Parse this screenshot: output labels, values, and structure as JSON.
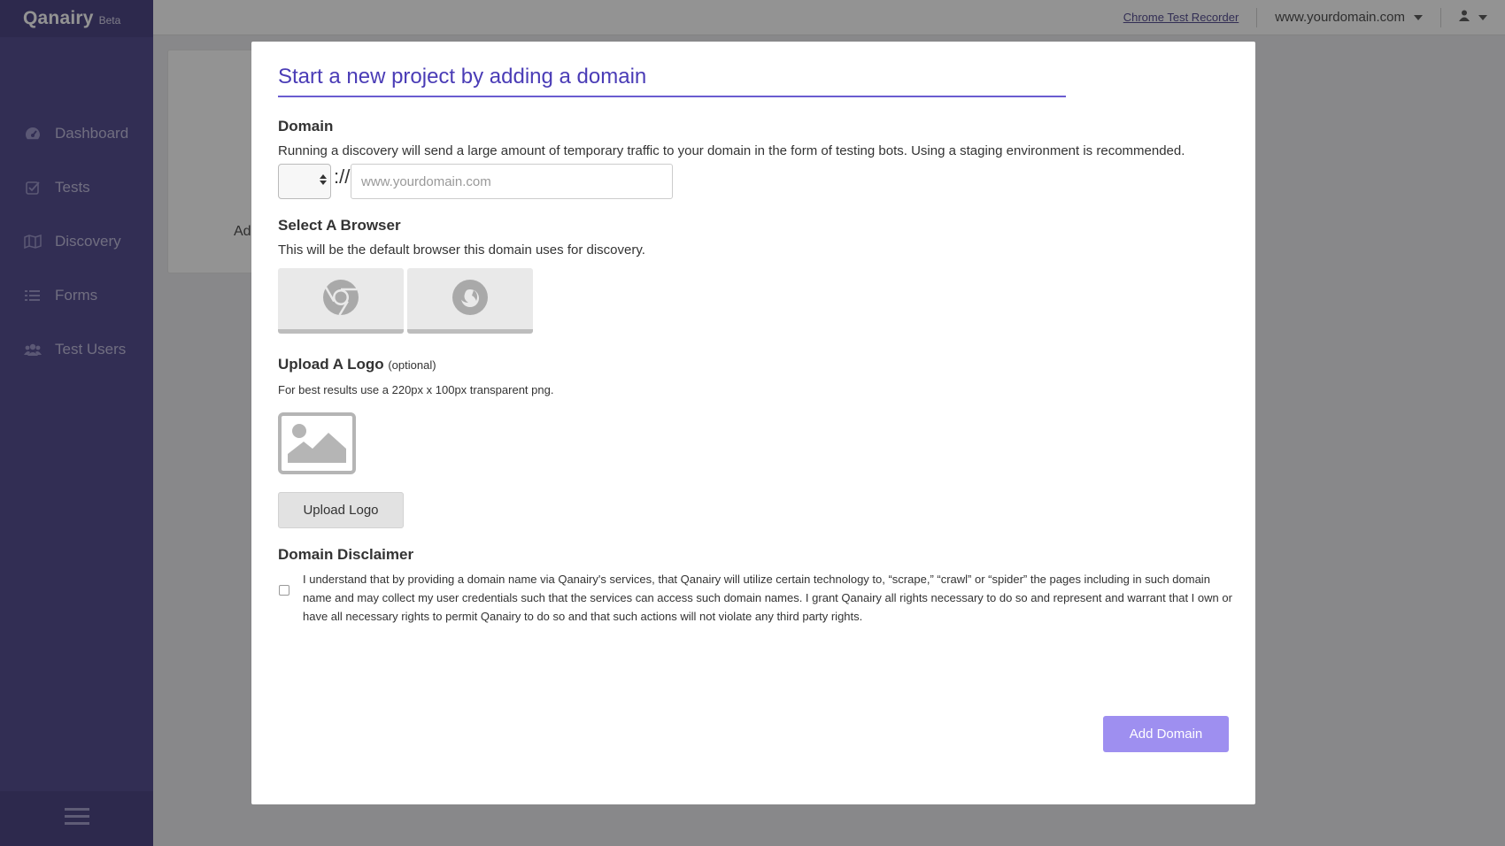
{
  "brand": {
    "name": "Qanairy",
    "badge": "Beta"
  },
  "sidebar": {
    "items": [
      {
        "label": "Dashboard",
        "icon": "dashboard-icon"
      },
      {
        "label": "Tests",
        "icon": "check-square-icon"
      },
      {
        "label": "Discovery",
        "icon": "map-icon"
      },
      {
        "label": "Forms",
        "icon": "list-icon"
      },
      {
        "label": "Test Users",
        "icon": "users-icon"
      }
    ],
    "footer_icon": "hamburger-icon"
  },
  "topbar": {
    "recorder_link": "Chrome Test Recorder",
    "domain": "www.yourdomain.com",
    "user_icon": "user-icon"
  },
  "background": {
    "card_text": "Ad"
  },
  "modal": {
    "title": "Start a new project by adding a domain",
    "domain": {
      "title": "Domain",
      "description": "Running a discovery will send a large amount of temporary traffic to your domain in the form of testing bots. Using a staging environment is recommended.",
      "protocol_separator": "://",
      "placeholder": "www.yourdomain.com"
    },
    "browser": {
      "title": "Select A Browser",
      "description": "This will be the default browser this domain uses for discovery.",
      "options": [
        "chrome-icon",
        "firefox-icon"
      ]
    },
    "logo": {
      "title": "Upload A Logo",
      "optional": "(optional)",
      "hint": "For best results use a 220px x 100px transparent png.",
      "button": "Upload Logo"
    },
    "disclaimer": {
      "title": "Domain Disclaimer",
      "text": "I understand that by providing a domain name via Qanairy's services, that Qanairy will utilize certain technology to, “scrape,” “crawl” or “spider” the pages including in such domain name and may collect my user credentials such that the services can access such domain names. I grant Qanairy all rights necessary to do so and represent and warrant that I own or have all necessary rights to permit Qanairy to do so and that such actions will not violate any third party rights."
    },
    "submit": "Add Domain"
  },
  "colors": {
    "sidebar": "#3d3481",
    "accent": "#4a3cb6",
    "submit": "#9e8ff0"
  }
}
